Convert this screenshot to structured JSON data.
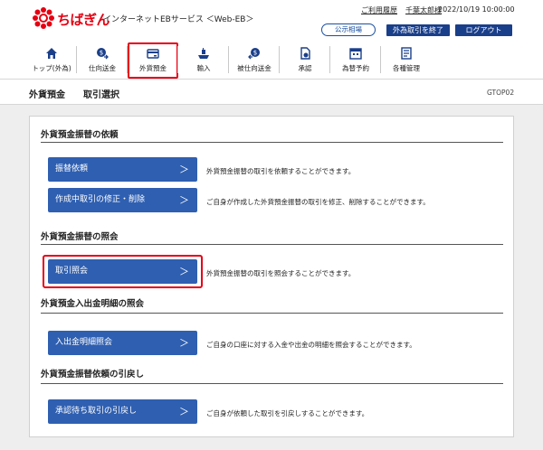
{
  "header": {
    "brand": "ちばぎん",
    "service": "インターネットEBサービス ＜Web-EB＞",
    "usage_history": "ご利用履歴",
    "user_name": "千葉太郎様",
    "datetime": "2022/10/19 10:00:00",
    "rate_button": "公示相場",
    "fx_end_button": "外為取引を終了",
    "logout_button": "ログアウト"
  },
  "nav": {
    "items": [
      {
        "label": "トップ(外為)",
        "icon": "home-icon"
      },
      {
        "label": "仕向送金",
        "icon": "outward-remittance-icon"
      },
      {
        "label": "外貨預金",
        "icon": "deposit-icon",
        "active": true
      },
      {
        "label": "輸入",
        "icon": "import-icon"
      },
      {
        "label": "被仕向送金",
        "icon": "inward-remittance-icon"
      },
      {
        "label": "承認",
        "icon": "approval-icon"
      },
      {
        "label": "為替予約",
        "icon": "exchange-contract-icon"
      },
      {
        "label": "各種管理",
        "icon": "management-icon"
      }
    ]
  },
  "breadcrumb": {
    "level1": "外貨預金",
    "level2": "取引選択",
    "screen_id": "GTOP02"
  },
  "sections": [
    {
      "title": "外貨預金振替の依頼",
      "actions": [
        {
          "label": "振替依頼",
          "desc": "外貨預金振替の取引を依頼することができます。"
        },
        {
          "label": "作成中取引の修正・削除",
          "desc": "ご自身が作成した外貨預金振替の取引を修正、削除することができます。"
        }
      ]
    },
    {
      "title": "外貨預金振替の照会",
      "actions": [
        {
          "label": "取引照会",
          "desc": "外貨預金振替の取引を照会することができます。"
        }
      ]
    },
    {
      "title": "外貨預金入出金明細の照会",
      "actions": [
        {
          "label": "入出金明細照会",
          "desc": "ご自身の口座に対する入金や出金の明細を照会することができます。"
        }
      ]
    },
    {
      "title": "外貨預金振替依頼の引戻し",
      "actions": [
        {
          "label": "承認待ち取引の引戻し",
          "desc": "ご自身が依頼した取引を引戻しすることができます。"
        }
      ]
    }
  ],
  "colors": {
    "brand_red": "#e40012",
    "button_blue": "#2f5fb1",
    "header_button_navy": "#1a3f8a",
    "highlight_red": "#e60012"
  },
  "chevron": "＞"
}
